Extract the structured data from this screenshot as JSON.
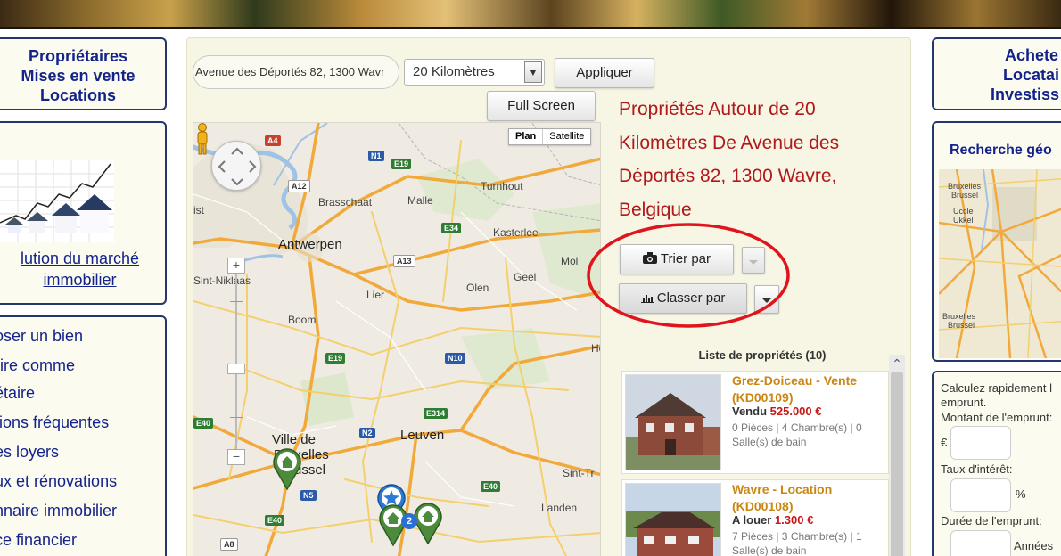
{
  "left_sidebar": {
    "top_box": {
      "lines": [
        "Propriétaires",
        "Mises en vente",
        "Locations"
      ]
    },
    "market_box": {
      "link_line1": "lution du marché",
      "link_line2": "immobilier"
    },
    "menu": {
      "items": [
        "oser un bien",
        "rire comme",
        "étaire",
        "tions fréquentes",
        "es loyers",
        "ux et rénovations",
        "nnaire immobilier",
        "ce financier"
      ]
    }
  },
  "search": {
    "address_value": "Avenue des Déportés 82, 1300 Wavr",
    "distance_selected": "20 Kilomètres",
    "apply_label": "Appliquer",
    "fullscreen_label": "Full Screen"
  },
  "map": {
    "map_types": [
      "Plan",
      "Satellite"
    ],
    "active_map_type": "Plan",
    "zoom_in": "+",
    "zoom_out": "−",
    "cluster_count": "2",
    "labels": [
      "Antwerpen",
      "Brasschaat",
      "Malle",
      "Turnhout",
      "Kasterlee",
      "Geel",
      "Mol",
      "Lier",
      "Olen",
      "Sint-Niklaas",
      "Boom",
      "Ville de",
      "Bruxelles",
      "Brussel",
      "Leuven",
      "Sint-Tr",
      "Landen",
      "He",
      "ist"
    ],
    "shields": [
      "A4",
      "N1",
      "E19",
      "A12",
      "E34",
      "A13",
      "E19",
      "N10",
      "E314",
      "N2",
      "E40",
      "E40",
      "N5",
      "A8",
      "E40"
    ]
  },
  "results": {
    "title": "Propriétés Autour de 20 Kilomètres De Avenue des Déportés 82, 1300 Wavre, Belgique",
    "sort_label": "Trier par",
    "classify_label": "Classer par",
    "list_header": "Liste de propriétés (10)",
    "properties": [
      {
        "title": "Grez-Doiceau - Vente (KD00109)",
        "status": "Vendu",
        "price": "525.000 €",
        "details": "0 Pièces | 4 Chambre(s) | 0 Salle(s) de bain"
      },
      {
        "title": "Wavre - Location (KD00108)",
        "status": "A louer",
        "price": "1.300 €",
        "details": "7 Pièces | 3 Chambre(s) | 1 Salle(s) de bain"
      }
    ]
  },
  "right_sidebar": {
    "top_box": {
      "lines": [
        "Achete",
        "Locatai",
        "Investiss"
      ]
    },
    "geo_title": "Recherche géo",
    "geo_labels": [
      "Bruxelles",
      "Brussel",
      "Uccle",
      "Ukkel",
      "Bruxelles",
      "Brussel"
    ],
    "calculator": {
      "intro_line1": "Calculez rapidement l",
      "intro_line2": "emprunt.",
      "amount_label": "Montant de l'emprunt:",
      "currency": "€",
      "rate_label": "Taux d'intérêt:",
      "percent": "%",
      "duration_label": "Durée de l'emprunt:",
      "years": "Années"
    }
  },
  "colors": {
    "title_red": "#b0181c",
    "nav_blue": "#14238a",
    "property_title": "#c98612",
    "price_red": "#c81818",
    "marker_green": "#4b8b3b",
    "marker_blue": "#2b7bd6",
    "ellipse_red": "#e0141c"
  },
  "icons": [
    "camera-icon",
    "bar-chart-icon",
    "house-marker-icon",
    "star-marker-icon",
    "pegman-icon",
    "pan-control-icon",
    "caret-down-icon",
    "scroll-up-icon"
  ]
}
